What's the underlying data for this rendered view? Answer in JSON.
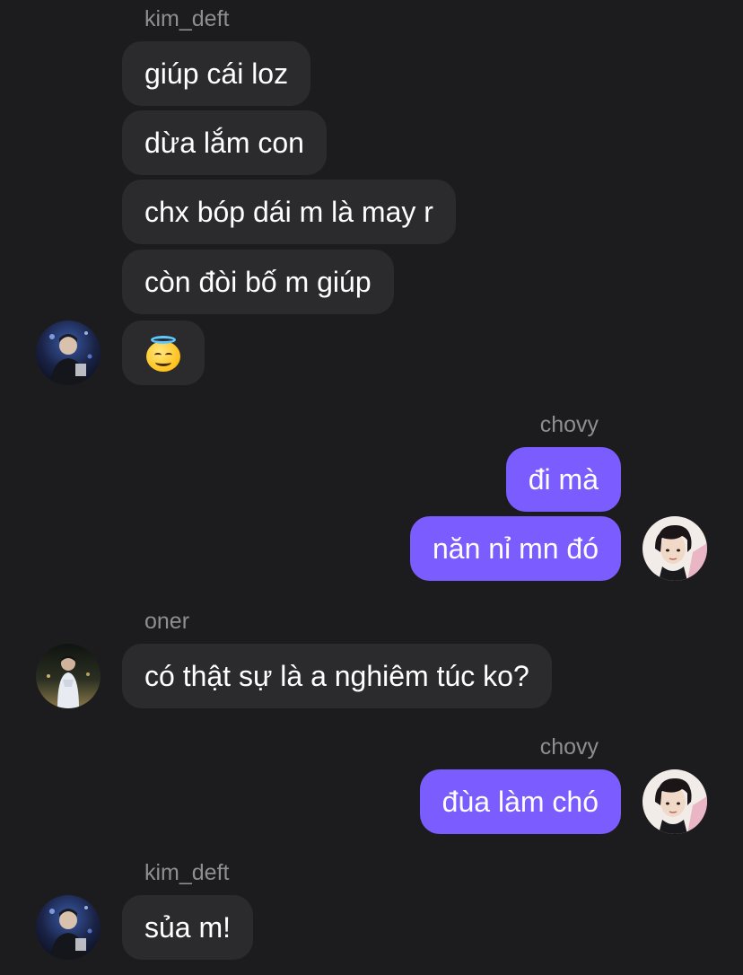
{
  "messages": [
    {
      "sender": "kim_deft",
      "side": "left",
      "bubbles": [
        "giúp cái loz",
        "dừa lắm con",
        "chx bóp dái m là may r",
        "còn đòi bố m giúp"
      ],
      "emoji_bubble": "smiling-face-with-halo"
    },
    {
      "sender": "chovy",
      "side": "right",
      "bubbles": [
        "đi mà",
        "năn nỉ mn đó"
      ]
    },
    {
      "sender": "oner",
      "side": "left",
      "bubbles": [
        "có thật sự là a nghiêm túc ko?"
      ]
    },
    {
      "sender": "chovy",
      "side": "right",
      "bubbles": [
        "đùa làm chó"
      ]
    },
    {
      "sender": "kim_deft",
      "side": "left",
      "bubbles": [
        "sủa m!"
      ]
    }
  ],
  "colors": {
    "background": "#1c1c1e",
    "incoming_bubble": "#2b2b2e",
    "outgoing_bubble": "#7a5cff",
    "sender_name": "#8e8e93"
  },
  "avatars": {
    "kim_deft": "avatar-kim-deft",
    "chovy": "avatar-chovy",
    "oner": "avatar-oner"
  }
}
